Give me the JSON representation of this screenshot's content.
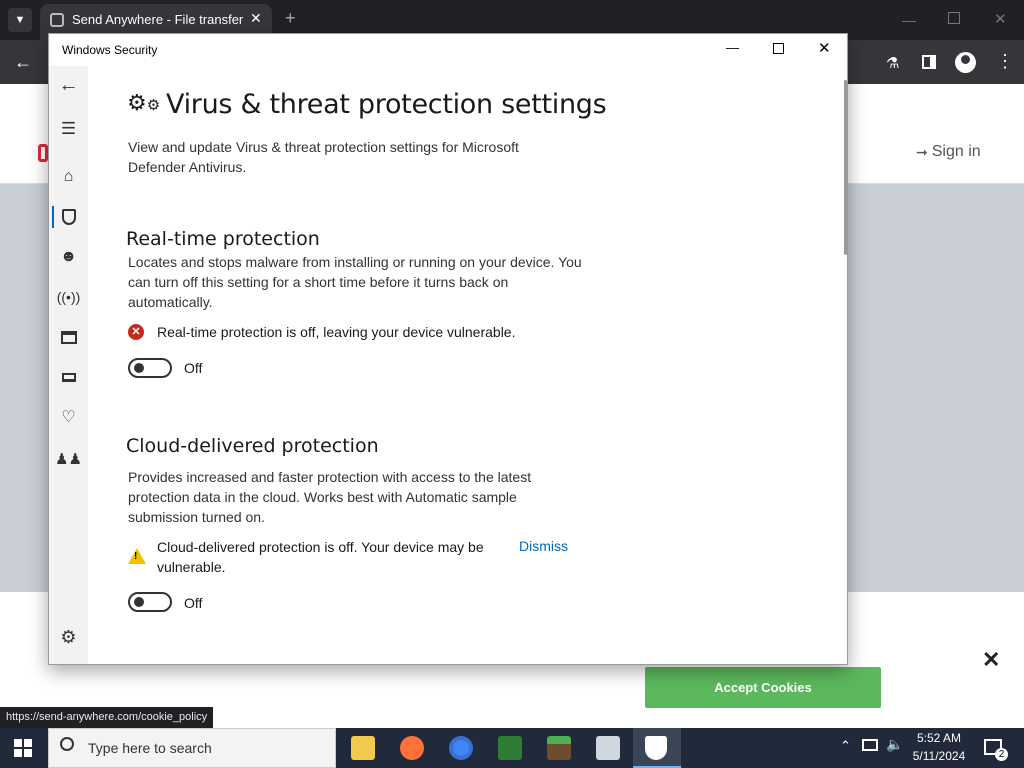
{
  "browser": {
    "tab_title": "Send Anywhere - File transfer",
    "sign_in": "Sign in",
    "status_url": "https://send-anywhere.com/cookie_policy"
  },
  "cookie": {
    "accept": "Accept Cookies"
  },
  "taskbar": {
    "search_placeholder": "Type here to search",
    "time": "5:52 AM",
    "date": "5/11/2024",
    "notification_count": "2"
  },
  "window": {
    "title": "Windows Security",
    "page_title": "Virus & threat protection settings",
    "page_desc_1": "View and update Virus & threat protection settings for Microsoft",
    "page_desc_2": "Defender Antivirus."
  },
  "realtime": {
    "heading": "Real-time protection",
    "desc_1": "Locates and stops malware from installing or running on your device. You",
    "desc_2": "can turn off this setting for a short time before it turns back on",
    "desc_3": "automatically.",
    "status": "Real-time protection is off, leaving your device vulnerable.",
    "toggle_label": "Off"
  },
  "cloud": {
    "heading": "Cloud-delivered protection",
    "desc_1": "Provides increased and faster protection with access to the latest",
    "desc_2": "protection data in the cloud. Works best with Automatic sample",
    "desc_3": "submission turned on.",
    "status_1": "Cloud-delivered protection is off. Your device may be",
    "status_2": "vulnerable.",
    "dismiss": "Dismiss",
    "toggle_label": "Off"
  },
  "colors": {
    "accent": "#0067c0",
    "error": "#c42b1c",
    "warning": "#f2c200",
    "accept_green": "#5cb85c"
  }
}
